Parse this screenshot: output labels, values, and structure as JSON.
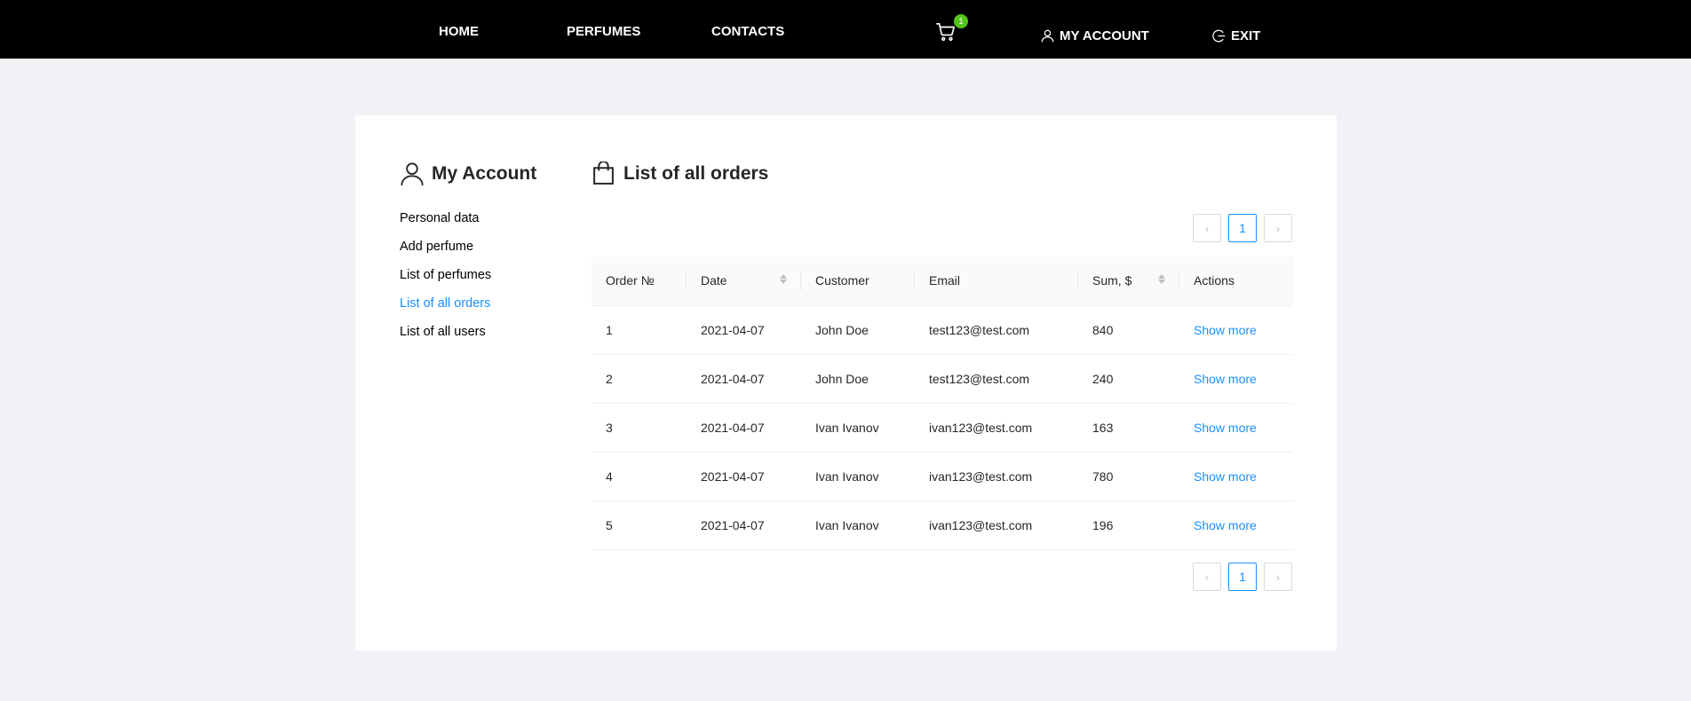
{
  "nav": {
    "home": "HOME",
    "perfumes": "PERFUMES",
    "contacts": "CONTACTS",
    "cart_count": "1",
    "my_account": "MY ACCOUNT",
    "exit": "EXIT"
  },
  "sidebar": {
    "title": "My Account",
    "items": [
      {
        "label": "Personal data"
      },
      {
        "label": "Add perfume"
      },
      {
        "label": "List of perfumes"
      },
      {
        "label": "List of all orders"
      },
      {
        "label": "List of all users"
      }
    ],
    "active_index": 3
  },
  "main": {
    "title": "List of all orders",
    "current_page": "1"
  },
  "table": {
    "headers": [
      "Order №",
      "Date",
      "Customer",
      "Email",
      "Sum, $",
      "Actions"
    ],
    "rows": [
      {
        "order": "1",
        "date": "2021-04-07",
        "customer": "John Doe",
        "email": "test123@test.com",
        "sum": "840",
        "action": "Show more"
      },
      {
        "order": "2",
        "date": "2021-04-07",
        "customer": "John Doe",
        "email": "test123@test.com",
        "sum": "240",
        "action": "Show more"
      },
      {
        "order": "3",
        "date": "2021-04-07",
        "customer": "Ivan Ivanov",
        "email": "ivan123@test.com",
        "sum": "163",
        "action": "Show more"
      },
      {
        "order": "4",
        "date": "2021-04-07",
        "customer": "Ivan Ivanov",
        "email": "ivan123@test.com",
        "sum": "780",
        "action": "Show more"
      },
      {
        "order": "5",
        "date": "2021-04-07",
        "customer": "Ivan Ivanov",
        "email": "ivan123@test.com",
        "sum": "196",
        "action": "Show more"
      }
    ]
  },
  "colors": {
    "accent": "#1890ff",
    "badge": "#52c41a",
    "topbar": "#000000",
    "page_bg": "#f0f2f5"
  }
}
